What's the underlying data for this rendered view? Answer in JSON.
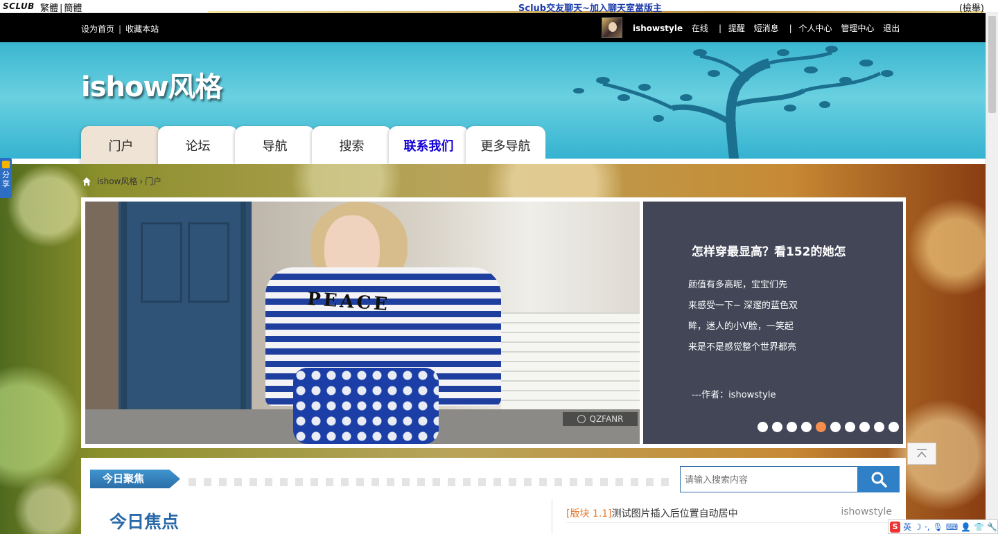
{
  "topbar": {
    "logo": "SCLUB",
    "lang_trad": "繁體",
    "lang_simp": "簡體",
    "banner": "Sclub交友聊天~加入聊天室當版主",
    "right_tag": "(檢舉)"
  },
  "blackbar": {
    "set_home": "设为首页",
    "bookmark": "收藏本站",
    "username": "ishowstyle",
    "online": "在线",
    "remind": "提醒",
    "messages": "短消息",
    "profile": "个人中心",
    "admin": "管理中心",
    "logout": "退出"
  },
  "header": {
    "title": "ishow风格"
  },
  "tabs": [
    {
      "label": "门户"
    },
    {
      "label": "论坛"
    },
    {
      "label": "导航"
    },
    {
      "label": "搜索"
    },
    {
      "label": "联系我们"
    },
    {
      "label": "更多导航"
    }
  ],
  "breadcrumb": {
    "site": "ishow风格",
    "sep": "›",
    "current": "门户"
  },
  "slider": {
    "image_text": "PEACE",
    "watermark": "QZFANR",
    "title": "怎样穿最显高？看152的她怎",
    "body": " 颜值有多高呢，宝宝们先\n来感受一下~ 深邃的蓝色双\n眸，迷人的小V脸，一笑起\n来是不是感觉整个世界都亮",
    "author": "---作者：ishowstyle",
    "dot_count": 10,
    "active_dot": 5
  },
  "lower": {
    "section_label": "今日聚焦",
    "search_placeholder": "请输入搜索内容",
    "focus_title": "今日焦点",
    "news": [
      {
        "board": "[版块 1.1]",
        "title": "测试图片插入后位置自动居中",
        "author": "ishowstyle"
      }
    ]
  },
  "share": {
    "label1": "分",
    "label2": "享"
  },
  "ime": {
    "lang": "英"
  },
  "colors": {
    "accent_blue": "#2f80c6",
    "header_cyan": "#3bb6d0",
    "active_dot": "#f58e4b",
    "contact_tab": "#1200d8"
  }
}
